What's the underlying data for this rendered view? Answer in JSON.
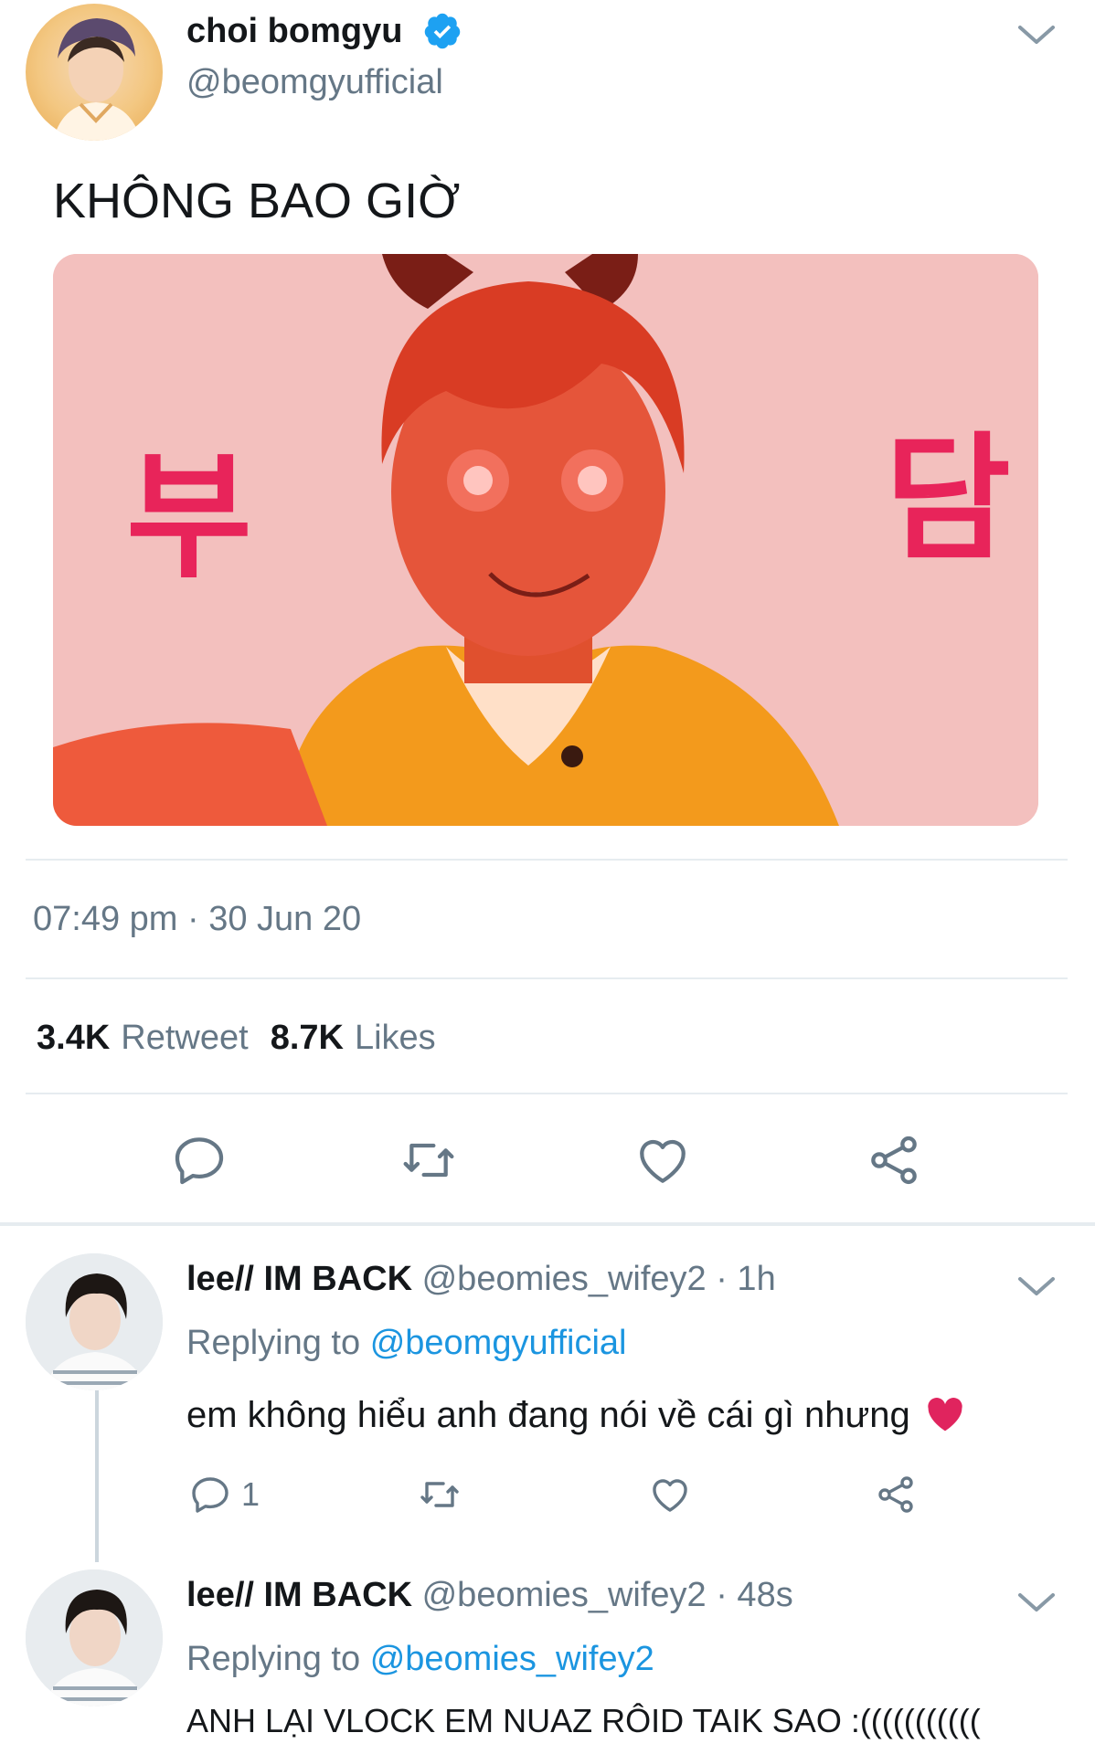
{
  "tweet": {
    "display_name": "choi bomgyu",
    "handle": "@beomgyufficial",
    "text": "KHÔNG BAO GIỜ",
    "image_text_left": "부",
    "image_text_right": "담",
    "timestamp": "07:49 pm · 30 Jun 20",
    "retweet_count": "3.4K",
    "retweet_label": "Retweet",
    "like_count": "8.7K",
    "like_label": "Likes"
  },
  "replies": [
    {
      "display_name": "lee// IM BACK",
      "handle_time": "@beomies_wifey2 · 1h",
      "replying_label": "Replying to",
      "replying_to": "@beomgyufficial",
      "text": "em không hiểu anh đang nói về cái gì nhưng",
      "emoji": "❤️",
      "reply_count": "1"
    },
    {
      "display_name": "lee// IM BACK",
      "handle_time": "@beomies_wifey2 · 48s",
      "replying_label": "Replying to",
      "replying_to": "@beomies_wifey2",
      "text": "ANH LẠI VLOCK EM NUAZ RÔID TAIK SAO :(((((((((((",
      "reply_count": ""
    }
  ],
  "colors": {
    "accent": "#1b95e0",
    "text_primary": "#14171a",
    "text_secondary": "#657786",
    "divider": "#e6ecf0",
    "heart_emoji": "#e0245e"
  },
  "icons": [
    "chevron-down-icon",
    "verified-badge-icon",
    "reply-icon",
    "retweet-icon",
    "like-icon",
    "share-icon"
  ]
}
